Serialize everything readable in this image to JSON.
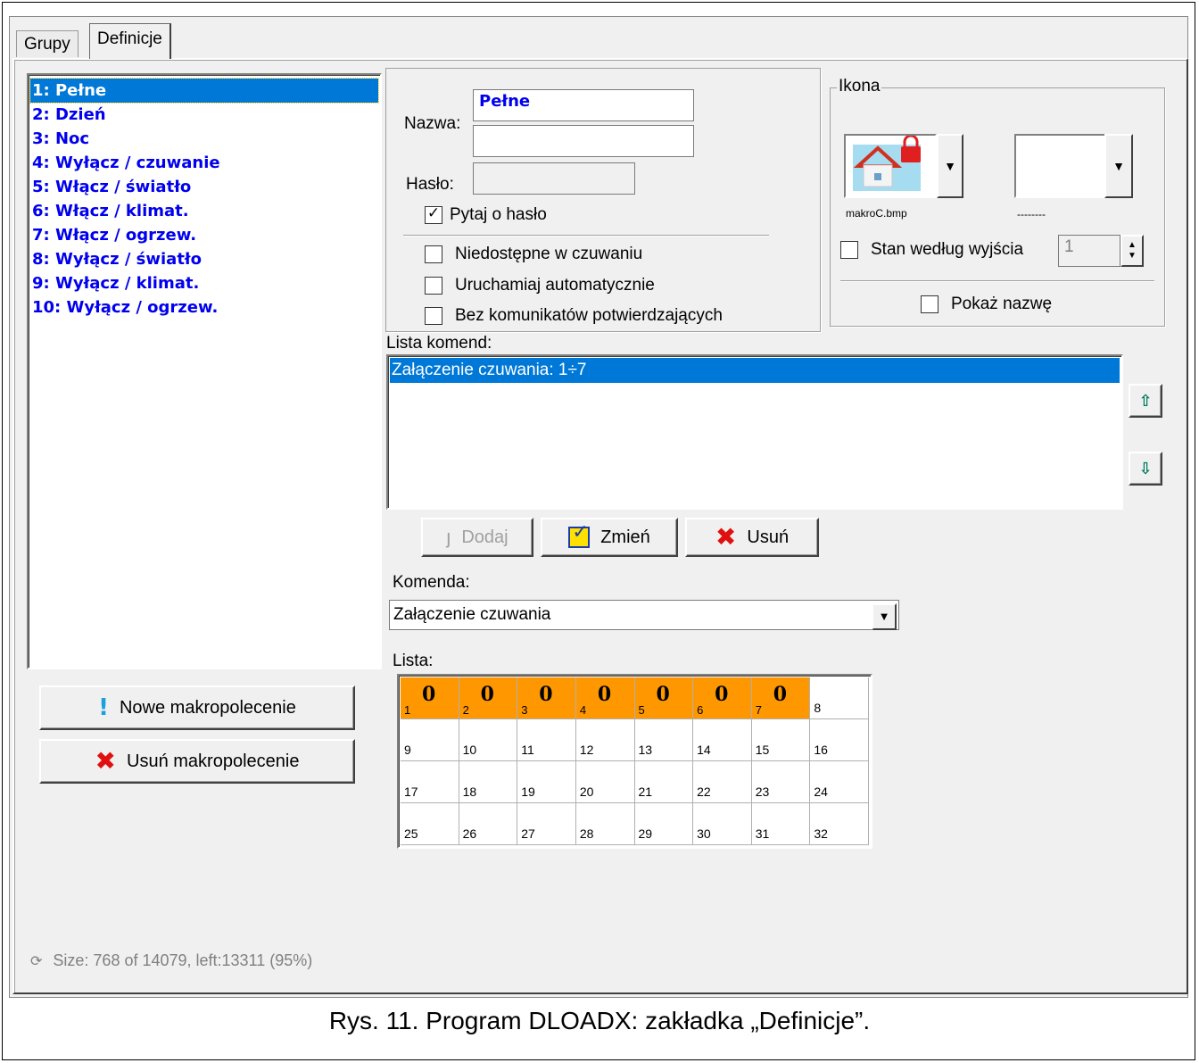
{
  "tabs": [
    "Grupy",
    "Definicje"
  ],
  "macros": [
    "1: Pełne",
    "2: Dzień",
    "3: Noc",
    "4: Wyłącz / czuwanie",
    "5: Włącz / światło",
    "6: Włącz / klimat.",
    "7: Włącz / ogrzew.",
    "8: Wyłącz / światło",
    "9: Wyłącz / klimat.",
    "10: Wyłącz / ogrzew."
  ],
  "buttons": {
    "new_macro": "Nowe makropolecenie",
    "delete_macro": "Usuń makropolecenie",
    "add": "Dodaj",
    "change": "Zmień",
    "delete": "Usuń"
  },
  "status": "Size: 768 of 14079, left:13311 (95%)",
  "form": {
    "name_label": "Nazwa:",
    "name_value": "Pełne",
    "name_value2": "",
    "password_label": "Hasło:",
    "ask_password": "Pytaj o hasło",
    "unavailable_armed": "Niedostępne w czuwaniu",
    "run_auto": "Uruchamiaj automatycznie",
    "no_confirm": "Bez komunikatów potwierdzających"
  },
  "icon_group": {
    "title": "Ikona",
    "icon1_file": "makroC.bmp",
    "icon2_file": "--------",
    "state_by_output": "Stan według wyjścia",
    "output_value": "1",
    "show_name": "Pokaż nazwę"
  },
  "commands": {
    "list_label": "Lista komend:",
    "items": [
      "Załączenie czuwania: 1÷7"
    ],
    "command_label": "Komenda:",
    "command_value": "Załączenie czuwania",
    "grid_label": "Lista:"
  },
  "grid": {
    "active": [
      1,
      2,
      3,
      4,
      5,
      6,
      7
    ],
    "active_value": "0",
    "count": 32
  },
  "caption": "Rys. 11. Program DLOADX: zakładka „Definicje”."
}
